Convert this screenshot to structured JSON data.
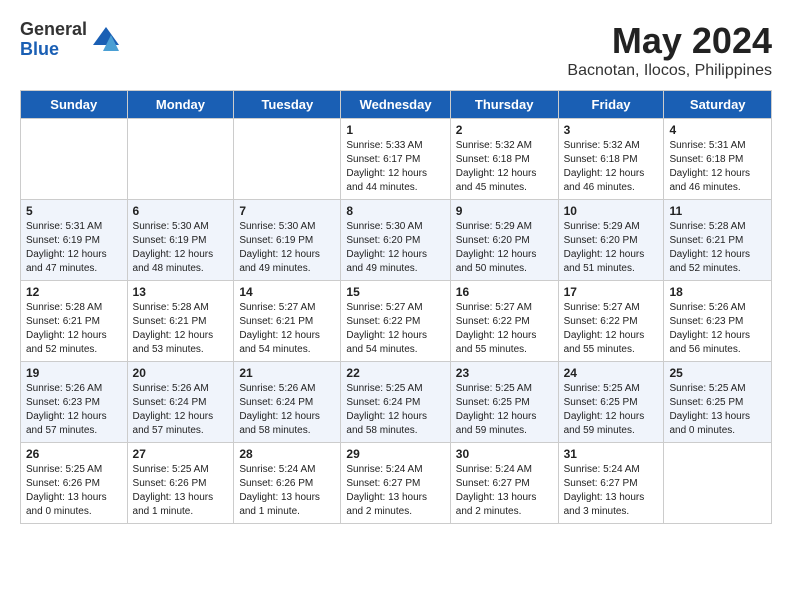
{
  "logo": {
    "general": "General",
    "blue": "Blue"
  },
  "title": {
    "month_year": "May 2024",
    "location": "Bacnotan, Ilocos, Philippines"
  },
  "days_of_week": [
    "Sunday",
    "Monday",
    "Tuesday",
    "Wednesday",
    "Thursday",
    "Friday",
    "Saturday"
  ],
  "weeks": [
    [
      {
        "day": "",
        "info": ""
      },
      {
        "day": "",
        "info": ""
      },
      {
        "day": "",
        "info": ""
      },
      {
        "day": "1",
        "info": "Sunrise: 5:33 AM\nSunset: 6:17 PM\nDaylight: 12 hours\nand 44 minutes."
      },
      {
        "day": "2",
        "info": "Sunrise: 5:32 AM\nSunset: 6:18 PM\nDaylight: 12 hours\nand 45 minutes."
      },
      {
        "day": "3",
        "info": "Sunrise: 5:32 AM\nSunset: 6:18 PM\nDaylight: 12 hours\nand 46 minutes."
      },
      {
        "day": "4",
        "info": "Sunrise: 5:31 AM\nSunset: 6:18 PM\nDaylight: 12 hours\nand 46 minutes."
      }
    ],
    [
      {
        "day": "5",
        "info": "Sunrise: 5:31 AM\nSunset: 6:19 PM\nDaylight: 12 hours\nand 47 minutes."
      },
      {
        "day": "6",
        "info": "Sunrise: 5:30 AM\nSunset: 6:19 PM\nDaylight: 12 hours\nand 48 minutes."
      },
      {
        "day": "7",
        "info": "Sunrise: 5:30 AM\nSunset: 6:19 PM\nDaylight: 12 hours\nand 49 minutes."
      },
      {
        "day": "8",
        "info": "Sunrise: 5:30 AM\nSunset: 6:20 PM\nDaylight: 12 hours\nand 49 minutes."
      },
      {
        "day": "9",
        "info": "Sunrise: 5:29 AM\nSunset: 6:20 PM\nDaylight: 12 hours\nand 50 minutes."
      },
      {
        "day": "10",
        "info": "Sunrise: 5:29 AM\nSunset: 6:20 PM\nDaylight: 12 hours\nand 51 minutes."
      },
      {
        "day": "11",
        "info": "Sunrise: 5:28 AM\nSunset: 6:21 PM\nDaylight: 12 hours\nand 52 minutes."
      }
    ],
    [
      {
        "day": "12",
        "info": "Sunrise: 5:28 AM\nSunset: 6:21 PM\nDaylight: 12 hours\nand 52 minutes."
      },
      {
        "day": "13",
        "info": "Sunrise: 5:28 AM\nSunset: 6:21 PM\nDaylight: 12 hours\nand 53 minutes."
      },
      {
        "day": "14",
        "info": "Sunrise: 5:27 AM\nSunset: 6:21 PM\nDaylight: 12 hours\nand 54 minutes."
      },
      {
        "day": "15",
        "info": "Sunrise: 5:27 AM\nSunset: 6:22 PM\nDaylight: 12 hours\nand 54 minutes."
      },
      {
        "day": "16",
        "info": "Sunrise: 5:27 AM\nSunset: 6:22 PM\nDaylight: 12 hours\nand 55 minutes."
      },
      {
        "day": "17",
        "info": "Sunrise: 5:27 AM\nSunset: 6:22 PM\nDaylight: 12 hours\nand 55 minutes."
      },
      {
        "day": "18",
        "info": "Sunrise: 5:26 AM\nSunset: 6:23 PM\nDaylight: 12 hours\nand 56 minutes."
      }
    ],
    [
      {
        "day": "19",
        "info": "Sunrise: 5:26 AM\nSunset: 6:23 PM\nDaylight: 12 hours\nand 57 minutes."
      },
      {
        "day": "20",
        "info": "Sunrise: 5:26 AM\nSunset: 6:24 PM\nDaylight: 12 hours\nand 57 minutes."
      },
      {
        "day": "21",
        "info": "Sunrise: 5:26 AM\nSunset: 6:24 PM\nDaylight: 12 hours\nand 58 minutes."
      },
      {
        "day": "22",
        "info": "Sunrise: 5:25 AM\nSunset: 6:24 PM\nDaylight: 12 hours\nand 58 minutes."
      },
      {
        "day": "23",
        "info": "Sunrise: 5:25 AM\nSunset: 6:25 PM\nDaylight: 12 hours\nand 59 minutes."
      },
      {
        "day": "24",
        "info": "Sunrise: 5:25 AM\nSunset: 6:25 PM\nDaylight: 12 hours\nand 59 minutes."
      },
      {
        "day": "25",
        "info": "Sunrise: 5:25 AM\nSunset: 6:25 PM\nDaylight: 13 hours\nand 0 minutes."
      }
    ],
    [
      {
        "day": "26",
        "info": "Sunrise: 5:25 AM\nSunset: 6:26 PM\nDaylight: 13 hours\nand 0 minutes."
      },
      {
        "day": "27",
        "info": "Sunrise: 5:25 AM\nSunset: 6:26 PM\nDaylight: 13 hours\nand 1 minute."
      },
      {
        "day": "28",
        "info": "Sunrise: 5:24 AM\nSunset: 6:26 PM\nDaylight: 13 hours\nand 1 minute."
      },
      {
        "day": "29",
        "info": "Sunrise: 5:24 AM\nSunset: 6:27 PM\nDaylight: 13 hours\nand 2 minutes."
      },
      {
        "day": "30",
        "info": "Sunrise: 5:24 AM\nSunset: 6:27 PM\nDaylight: 13 hours\nand 2 minutes."
      },
      {
        "day": "31",
        "info": "Sunrise: 5:24 AM\nSunset: 6:27 PM\nDaylight: 13 hours\nand 3 minutes."
      },
      {
        "day": "",
        "info": ""
      }
    ]
  ]
}
